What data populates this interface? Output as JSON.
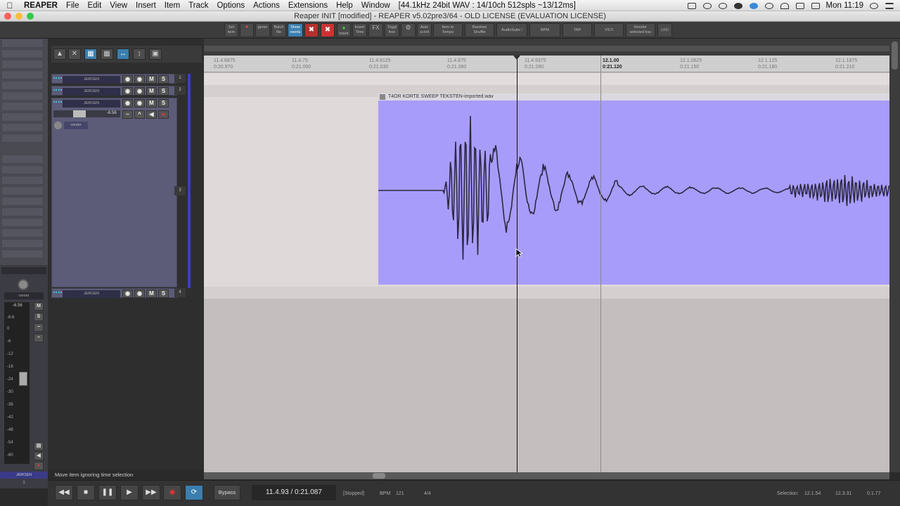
{
  "menubar": {
    "apple": "",
    "items": [
      "REAPER",
      "File",
      "Edit",
      "View",
      "Insert",
      "Item",
      "Track",
      "Options",
      "Actions",
      "Extensions",
      "Help",
      "Window",
      "[44.1kHz 24bit WAV : 14/10ch 512spls ~13/12ms]"
    ],
    "clock": "Mon 11:19"
  },
  "window": {
    "title": "Reaper INIT [modified] - REAPER v5.02pre3/64 - OLD LICENSE (EVALUATION LICENSE)"
  },
  "toolbar": {
    "buttons": [
      {
        "l1": "Set",
        "l2": "item"
      },
      {
        "l1": "",
        "l2": ""
      },
      {
        "l1": "gener",
        "l2": ""
      },
      {
        "l1": "Batch",
        "l2": "file"
      },
      {
        "l1": "Show",
        "l2": "overla"
      },
      {
        "l1": "",
        "l2": ""
      },
      {
        "l1": "",
        "l2": ""
      },
      {
        "l1": "",
        "l2": "insert"
      },
      {
        "l1": "Insert",
        "l2": "Time"
      },
      {
        "l1": "FX",
        "l2": ""
      },
      {
        "l1": "Toggl",
        "l2": "free"
      },
      {
        "l1": "",
        "l2": ""
      },
      {
        "l1": "Auto",
        "l2": "scroll"
      },
      {
        "l1": "Item to",
        "l2": "Tempo"
      },
      {
        "l1": "Random",
        "l2": "Shuffle"
      },
      {
        "l1": "AudioSuite !",
        "l2": ""
      },
      {
        "l1": "BPM",
        "l2": ""
      },
      {
        "l1": "TAP",
        "l2": ""
      },
      {
        "l1": "VSTi",
        "l2": ""
      },
      {
        "l1": "Render",
        "l2": "selected trac"
      },
      {
        "l1": "LFO",
        "l2": ""
      }
    ]
  },
  "tracks": [
    {
      "name": "JEROEN",
      "num": "1"
    },
    {
      "name": "JEROEN",
      "num": "2"
    },
    {
      "name": "JEROEN",
      "num": "3",
      "volume": "-6.56",
      "pan": "center"
    },
    {
      "name": "JEROEN",
      "num": "4"
    }
  ],
  "track_buttons": {
    "mute": "M",
    "solo": "S"
  },
  "timeline": {
    "ticks": [
      {
        "bar": "11.4.6875",
        "time": "0:20.970"
      },
      {
        "bar": "11.4.75",
        "time": "0:21.000"
      },
      {
        "bar": "11.4.8125",
        "time": "0:21.030"
      },
      {
        "bar": "11.4.875",
        "time": "0:21.060"
      },
      {
        "bar": "11.4.9375",
        "time": "0:21.090"
      },
      {
        "bar": "12.1.00",
        "time": "0:21.120"
      },
      {
        "bar": "12.1.0625",
        "time": "0:21.150"
      },
      {
        "bar": "12.1.125",
        "time": "0:21.180"
      },
      {
        "bar": "12.1.1875",
        "time": "0:21.210"
      }
    ]
  },
  "item": {
    "name": "T4OR KORTE SWEEP TEKSTEN-imported.wav",
    "color": "#a89cfb"
  },
  "status": {
    "text": "Move item ignoring time selection"
  },
  "master": {
    "pan": "center",
    "volume": "-6.56",
    "scale": [
      "-6.6",
      "0",
      "-6",
      "-12",
      "-18",
      "-24",
      "-30",
      "-36",
      "-42",
      "-48",
      "-54",
      "-60"
    ],
    "name": "JEROEN",
    "num": "1",
    "mute": "M",
    "solo": "S"
  },
  "transport": {
    "bypass": "Bypass",
    "position": "11.4.93 / 0:21.087",
    "state": "[Stopped]",
    "bpm_label": "BPM",
    "bpm": "121",
    "signature": "4/4",
    "selection_label": "Selection:",
    "sel_start": "12.1.54",
    "sel_end": "12.3.31",
    "sel_len": "0.1.77"
  }
}
